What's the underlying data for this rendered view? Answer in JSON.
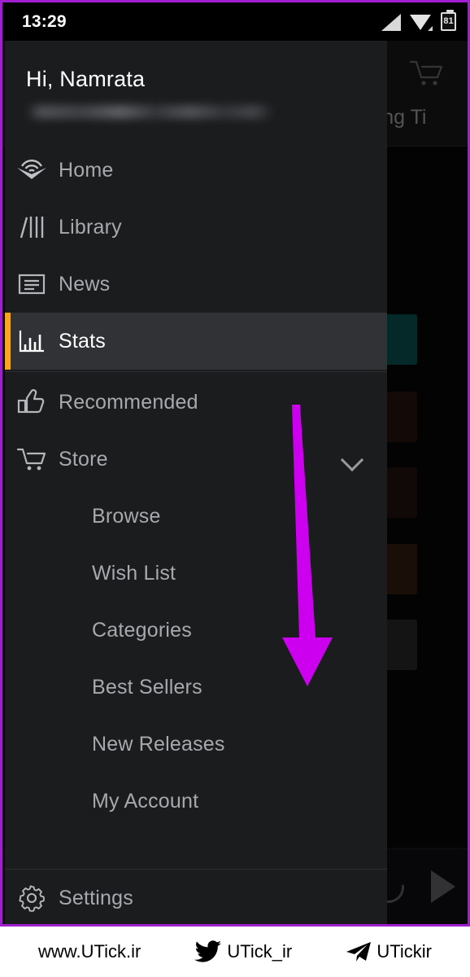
{
  "status_bar": {
    "time": "13:29",
    "battery_level": "81",
    "icons": [
      "signal-icon",
      "wifi-icon",
      "battery-icon"
    ]
  },
  "background_app": {
    "title": "Listening Ti",
    "cart_icon": "cart-icon",
    "player": {
      "replay_icon": "replay-icon",
      "play_icon": "play-icon"
    },
    "thumbnails": [
      {
        "color": "#0d5c5c",
        "top": "205"
      },
      {
        "color": "#2a1610",
        "top": "300"
      },
      {
        "color": "#271512",
        "top": "393"
      },
      {
        "color": "#3a2016",
        "top": "487"
      },
      {
        "color": "#2e2e30",
        "top": "580"
      }
    ]
  },
  "drawer": {
    "greeting": "Hi, Namrata",
    "email_redacted": true,
    "nav": [
      {
        "label": "Home",
        "icon": "audible-logo-icon",
        "active": false
      },
      {
        "label": "Library",
        "icon": "library-icon",
        "active": false
      },
      {
        "label": "News",
        "icon": "news-icon",
        "active": false
      },
      {
        "label": "Stats",
        "icon": "stats-bar-chart-icon",
        "active": true
      }
    ],
    "nav2": [
      {
        "label": "Recommended",
        "icon": "thumbs-up-icon",
        "expandable": false
      },
      {
        "label": "Store",
        "icon": "cart-icon",
        "expandable": true
      }
    ],
    "store_subitems": [
      {
        "label": "Browse"
      },
      {
        "label": "Wish List"
      },
      {
        "label": "Categories"
      },
      {
        "label": "Best Sellers"
      },
      {
        "label": "New Releases"
      },
      {
        "label": "My Account"
      }
    ],
    "footer": {
      "label": "Settings",
      "icon": "gear-icon"
    },
    "accent_color": "#f5a623",
    "active_bg": "#303236",
    "bg_color": "#1a1c1e"
  },
  "annotation": {
    "type": "arrow-down",
    "color": "#cc00ee"
  },
  "watermark": {
    "site": "www.UTick.ir",
    "twitter_handle": "UTick_ir",
    "telegram_handle": "UTickir",
    "twitter_icon": "twitter-bird-icon",
    "telegram_icon": "telegram-plane-icon"
  }
}
